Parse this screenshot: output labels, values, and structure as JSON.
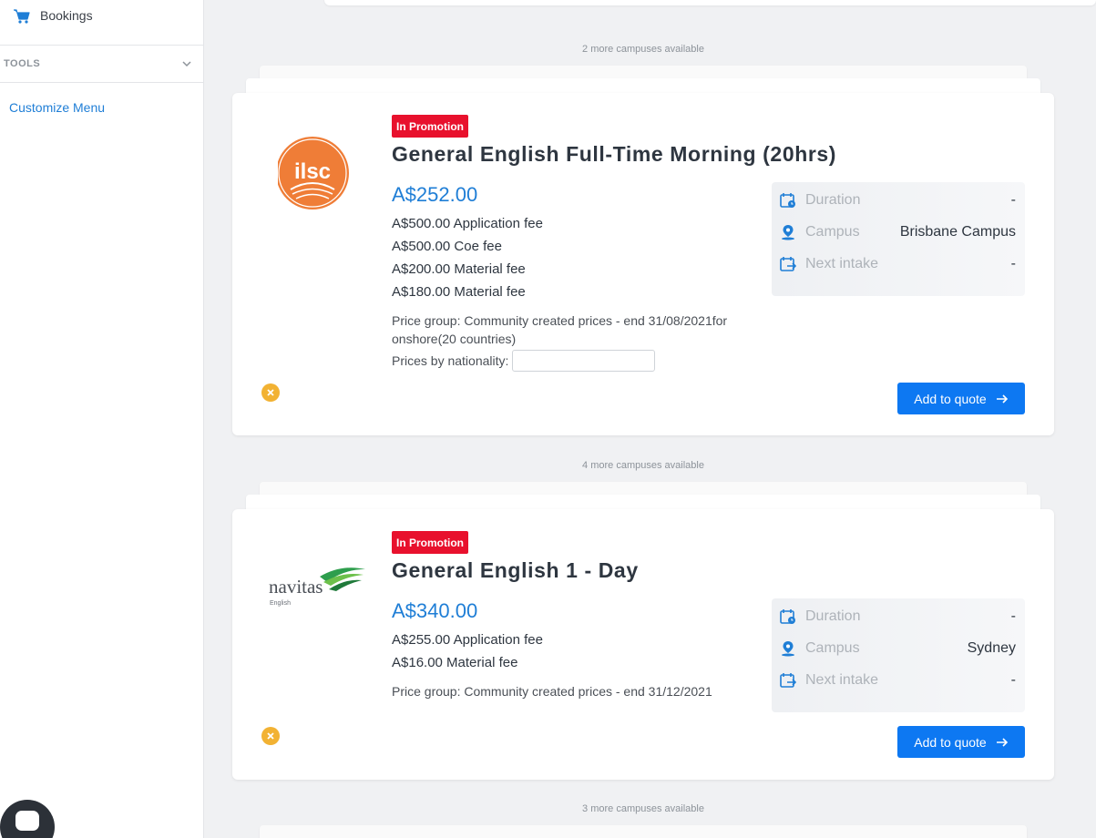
{
  "sidebar": {
    "bookings": {
      "label": "Bookings",
      "icon": "cart-icon"
    },
    "tools": {
      "label": "TOOLS",
      "icon": "chevron-down-icon"
    },
    "customize_menu": "Customize Menu",
    "chat_icon": "chat-icon"
  },
  "colors": {
    "accent": "#1f7ed6",
    "button": "#0d78f2",
    "promo": "#e8112d",
    "remove": "#f2b233",
    "ilsc_orange": "#ef7d37",
    "navitas_green": "#2e9e4d"
  },
  "listing": {
    "more_campuses": [
      "2 more campuses available",
      "4 more campuses available",
      "3 more campuses available"
    ],
    "courses": [
      {
        "logo": "ilsc",
        "badge": "In Promotion",
        "title": "General English Full-Time Morning (20hrs)",
        "price": "A$252.00",
        "fees": [
          "A$500.00 Application fee",
          "A$500.00 Coe fee",
          "A$200.00 Material fee",
          "A$180.00 Material fee"
        ],
        "price_group": "Price group: Community created prices - end 31/08/2021for onshore(20 countries)",
        "prices_by_nationality_label": "Prices by nationality:",
        "prices_by_nationality_value": "",
        "info": {
          "duration_label": "Duration",
          "duration_value": "-",
          "campus_label": "Campus",
          "campus_value": "Brisbane Campus",
          "intake_label": "Next intake",
          "intake_value": "-"
        },
        "add_label": "Add to quote"
      },
      {
        "logo": "navitas",
        "logo_text": "navitas",
        "logo_sub": "English",
        "badge": "In Promotion",
        "title": "General English 1 - Day",
        "price": "A$340.00",
        "fees": [
          "A$255.00 Application fee",
          "A$16.00 Material fee"
        ],
        "price_group": "Price group: Community created prices - end 31/12/2021",
        "info": {
          "duration_label": "Duration",
          "duration_value": "-",
          "campus_label": "Campus",
          "campus_value": "Sydney",
          "intake_label": "Next intake",
          "intake_value": "-"
        },
        "add_label": "Add to quote"
      }
    ]
  }
}
